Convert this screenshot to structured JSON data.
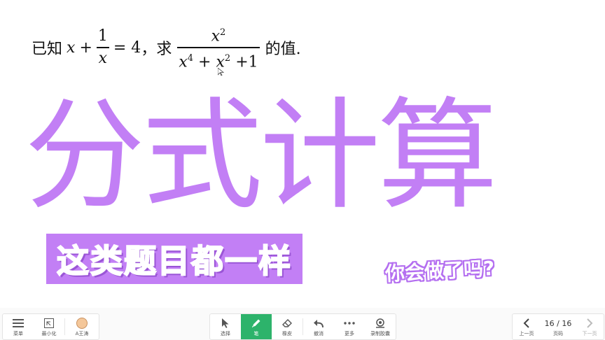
{
  "slide": {
    "question": {
      "prefix": "已知",
      "eq_var": "x",
      "plus": "+",
      "one": "1",
      "den_var": "x",
      "eq_value": "= 4",
      "comma": "，",
      "ask": "求",
      "frac_num_var": "x",
      "frac_num_exp": "2",
      "frac_den_a": "x",
      "frac_den_a_exp": "4",
      "frac_den_plus1": "+",
      "frac_den_b": "x",
      "frac_den_b_exp": "2",
      "frac_den_tail": "+1",
      "suffix": "的值."
    },
    "title": "分式计算",
    "banner": "这类题目都一样",
    "side_note": "你会做了吗?"
  },
  "toolbar": {
    "left": [
      {
        "icon": "menu-icon",
        "label": "菜单"
      },
      {
        "icon": "minimize-icon",
        "label": "最小化"
      },
      {
        "icon": "avatar-icon",
        "label": "A王涛"
      }
    ],
    "center": [
      {
        "icon": "cursor-icon",
        "label": "选择"
      },
      {
        "icon": "pen-icon",
        "label": "笔",
        "active": true
      },
      {
        "icon": "eraser-icon",
        "label": "橡皮"
      },
      {
        "icon": "undo-icon",
        "label": "撤消"
      },
      {
        "icon": "more-icon",
        "label": "更多"
      },
      {
        "icon": "record-icon",
        "label": "录制胶囊"
      }
    ],
    "right": {
      "prev_label": "上一页",
      "page_indicator": "16 / 16",
      "page_label": "页码",
      "next_label": "下一页"
    }
  },
  "colors": {
    "title_purple": "#c27ff5",
    "active_green": "#2db36b"
  }
}
